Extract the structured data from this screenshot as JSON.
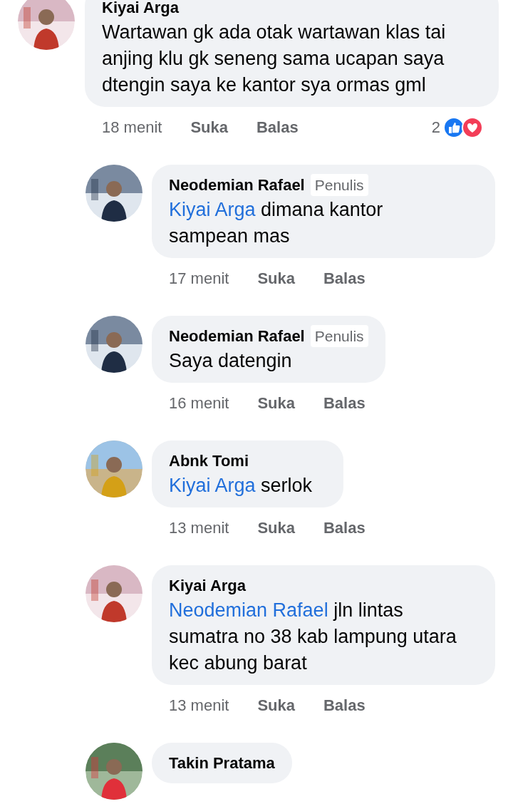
{
  "comments": [
    {
      "kind": "comment",
      "author": "Kiyai Arga",
      "text": "Wartawan gk ada otak wartawan klas tai anjing klu gk seneng sama ucapan saya dtengin saya ke kantor sya ormas gml",
      "time": "18 menit",
      "actions": [
        "Suka",
        "Balas"
      ],
      "reaction_count": "2"
    },
    {
      "kind": "reply",
      "author": "Neodemian Rafael",
      "badge": "Penulis",
      "mention": "Kiyai Arga",
      "text": "dimana kantor sampean mas",
      "time": "17 menit",
      "actions": [
        "Suka",
        "Balas"
      ]
    },
    {
      "kind": "reply",
      "author": "Neodemian Rafael",
      "badge": "Penulis",
      "text": "Saya datengin",
      "time": "16 menit",
      "actions": [
        "Suka",
        "Balas"
      ]
    },
    {
      "kind": "reply",
      "author": "Abnk Tomi",
      "mention": "Kiyai Arga",
      "text": "serlok",
      "time": "13 menit",
      "actions": [
        "Suka",
        "Balas"
      ]
    },
    {
      "kind": "reply",
      "author": "Kiyai Arga",
      "mention": "Neodemian Rafael",
      "text": "jln lintas sumatra no 38 kab lampung utara kec abung barat",
      "time": "13 menit",
      "actions": [
        "Suka",
        "Balas"
      ]
    },
    {
      "kind": "reply",
      "author": "Takin Pratama"
    }
  ]
}
